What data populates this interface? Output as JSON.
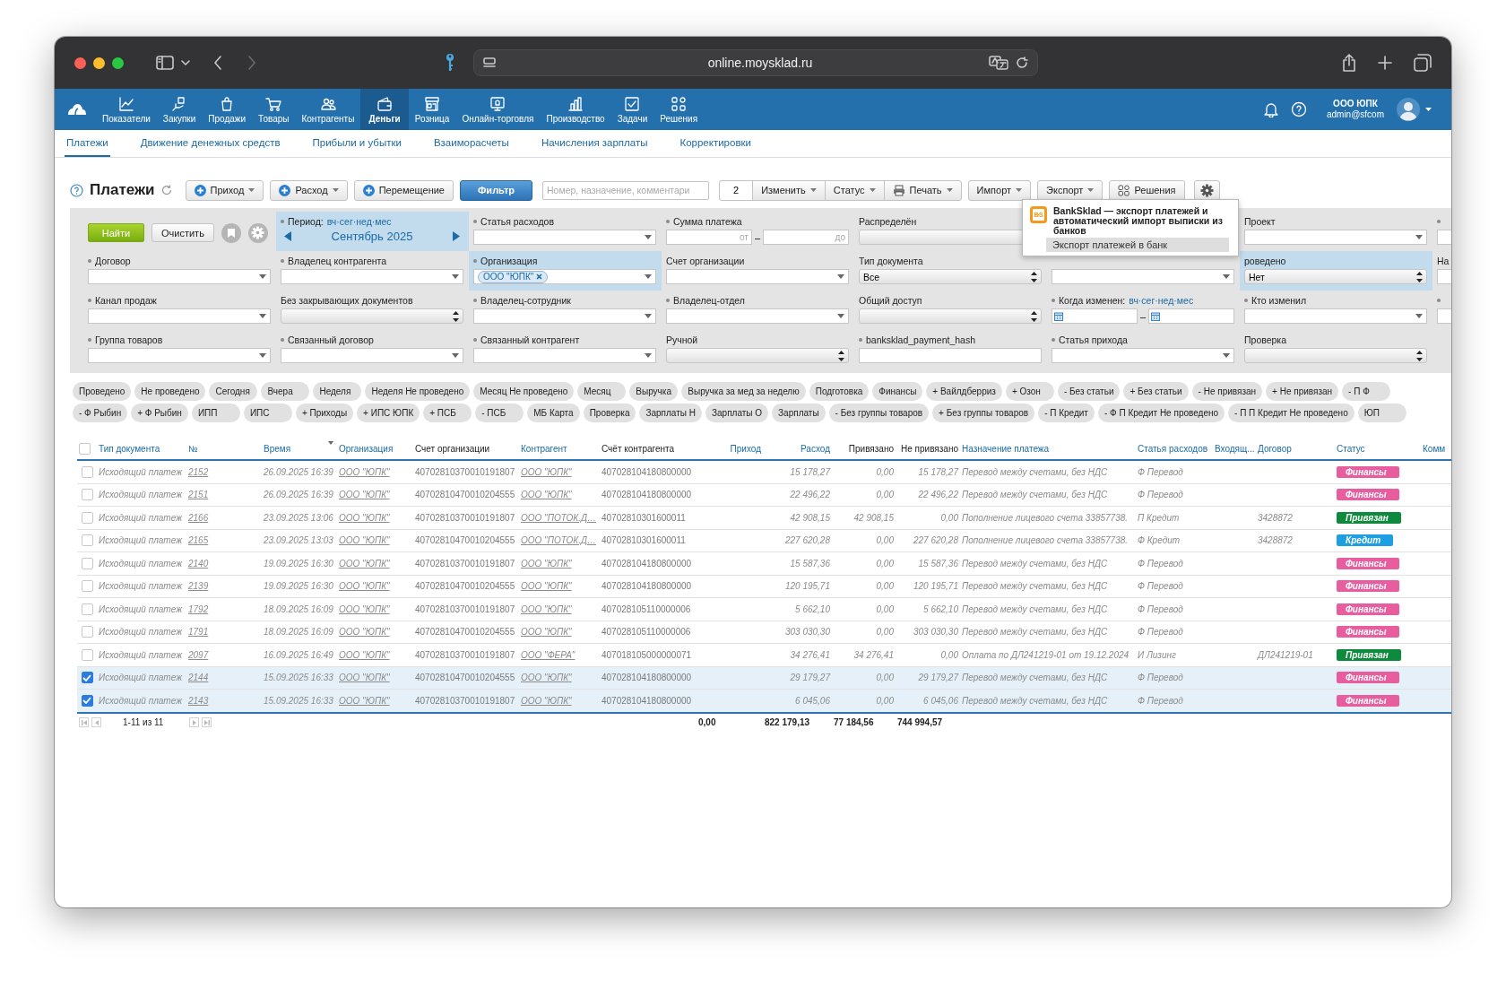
{
  "browser": {
    "url": "online.moysklad.ru"
  },
  "nav": {
    "items": [
      {
        "label": "Показатели",
        "selected": false
      },
      {
        "label": "Закупки",
        "selected": false
      },
      {
        "label": "Продажи",
        "selected": false
      },
      {
        "label": "Товары",
        "selected": false
      },
      {
        "label": "Контрагенты",
        "selected": false
      },
      {
        "label": "Деньги",
        "selected": true
      },
      {
        "label": "Розница",
        "selected": false
      },
      {
        "label": "Онлайн-торговля",
        "selected": false
      },
      {
        "label": "Производство",
        "selected": false
      },
      {
        "label": "Задачи",
        "selected": false
      },
      {
        "label": "Решения",
        "selected": false
      }
    ],
    "account": {
      "company": "ООО ЮПК",
      "email": "admin@sfcom"
    }
  },
  "subtabs": [
    {
      "label": "Платежи",
      "selected": true
    },
    {
      "label": "Движение денежных средств",
      "selected": false
    },
    {
      "label": "Прибыли и убытки",
      "selected": false
    },
    {
      "label": "Взаиморасчеты",
      "selected": false
    },
    {
      "label": "Начисления зарплаты",
      "selected": false
    },
    {
      "label": "Корректировки",
      "selected": false
    }
  ],
  "toolbar": {
    "title": "Платежи",
    "create_buttons": [
      {
        "label": "Приход",
        "caret": true
      },
      {
        "label": "Расход",
        "caret": true
      },
      {
        "label": "Перемещение",
        "caret": false
      }
    ],
    "filter_button": {
      "label": "Фильтр",
      "on": true
    },
    "search": {
      "placeholder": "Номер, назначение, комментари"
    },
    "selected_count": "2",
    "selection_menus": [
      {
        "label": "Изменить",
        "kind": "menu"
      },
      {
        "label": "Статус",
        "kind": "menu"
      },
      {
        "label": "Печать",
        "kind": "print"
      }
    ],
    "menus": [
      {
        "label": "Импорт",
        "kind": "menu"
      },
      {
        "label": "Экспорт",
        "kind": "menu"
      },
      {
        "label": "Решения",
        "kind": "apps"
      }
    ]
  },
  "solutions_popup": {
    "logo": "BS",
    "title": "BankSklad — экспорт платежей и автоматический импорт выписки из банков",
    "items": [
      {
        "label": "Экспорт платежей в банк",
        "selected": true
      }
    ]
  },
  "filter": {
    "rows": [
      [
        {
          "kind": "actions",
          "find": "Найти",
          "clear": "Очистить"
        },
        {
          "kind": "period",
          "label": "Период:",
          "shortcuts": "вч·сег·нед·мес",
          "month": "Сентябрь 2025",
          "highlighted": true
        },
        {
          "label": "Статья расходов",
          "bullet": true,
          "kind": "combo"
        },
        {
          "label": "Сумма платежа",
          "bullet": true,
          "kind": "range",
          "inputs": [
            {
              "placeholder": "от"
            },
            {
              "placeholder": "до"
            }
          ],
          "separator": "–"
        },
        {
          "label": "Распределён",
          "bullet": false,
          "kind": "select"
        },
        "",
        {
          "label": "Проект",
          "bullet": false,
          "kind": "combo"
        },
        {
          "bullet": true,
          "kind": "combo"
        }
      ],
      [
        {
          "label": "Договор",
          "bullet": true,
          "kind": "combo"
        },
        {
          "label": "Владелец контрагента",
          "bullet": true,
          "kind": "combo"
        },
        {
          "label": "Организация",
          "bullet": true,
          "kind": "chips",
          "highlighted": true,
          "chips": [
            "ООО \"ЮПК\""
          ]
        },
        {
          "label": "Счет организации",
          "bullet": false,
          "kind": "combo"
        },
        {
          "label": "Тип документа",
          "bullet": false,
          "kind": "select",
          "value": "Все"
        },
        {
          "bullet": false,
          "kind": "combo"
        },
        {
          "label": "роведено",
          "bullet": false,
          "kind": "select",
          "value": "Нет",
          "highlighted": true
        },
        {
          "label": "На",
          "bullet": false,
          "kind": "combo"
        }
      ],
      [
        {
          "label": "Канал продаж",
          "bullet": true,
          "kind": "combo"
        },
        {
          "label": "Без закрывающих документов",
          "bullet": false,
          "kind": "select"
        },
        {
          "label": "Владелец-сотрудник",
          "bullet": true,
          "kind": "combo"
        },
        {
          "label": "Владелец-отдел",
          "bullet": true,
          "kind": "combo"
        },
        {
          "label": "Общий доступ",
          "bullet": false,
          "kind": "select"
        },
        {
          "label": "Когда изменен:",
          "bullet": true,
          "kind": "dates",
          "shortcuts": "вч·сег·нед·мес",
          "separator": "–"
        },
        {
          "label": "Кто изменил",
          "bullet": true,
          "kind": "combo"
        },
        {
          "bullet": true,
          "kind": "combo"
        }
      ],
      [
        {
          "label": "Группа товаров",
          "bullet": true,
          "kind": "combo"
        },
        {
          "label": "Связанный договор",
          "bullet": true,
          "kind": "combo"
        },
        {
          "label": "Связанный контрагент",
          "bullet": true,
          "kind": "combo"
        },
        {
          "label": "Ручной",
          "bullet": false,
          "kind": "select"
        },
        {
          "label": "banksklad_payment_hash",
          "bullet": true,
          "kind": "text"
        },
        {
          "label": "Статья прихода",
          "bullet": true,
          "kind": "combo"
        },
        {
          "label": "Проверка",
          "bullet": false,
          "kind": "select"
        }
      ]
    ]
  },
  "quick_filters": [
    [
      "Проведено",
      "Не проведено",
      "Сегодня",
      "Вчера",
      "Неделя",
      "Неделя Не проведено",
      "Месяц Не проведено",
      "Месяц",
      "Выручка",
      "Выручка за мед за неделю",
      "Подготовка",
      "Финансы",
      "+ Вайлдберриз",
      "+ Озон",
      "- Без статьи",
      "+ Без статьи",
      "- Не привязан",
      "+ Не привязан",
      "- П Ф"
    ],
    [
      "- Ф Рыбин",
      "+ Ф Рыбин",
      "ИПП",
      "ИПС",
      "+ Приходы",
      "+ ИПС ЮПК",
      "+ ПСБ",
      "- ПСБ",
      "МБ Карта",
      "Проверка",
      "Зарплаты Н",
      "Зарплаты О",
      "Зарплаты",
      "- Без группы товаров",
      "+ Без группы товаров",
      "- П Кредит",
      "- Ф П Кредит Не проведено",
      "- П П Кредит Не проведено",
      "ЮП"
    ]
  ],
  "table": {
    "all_selected": false,
    "columns": [
      {
        "label": "Тип документа",
        "kind": "text",
        "sortable": true,
        "sorted": false
      },
      {
        "label": "№",
        "kind": "link",
        "sortable": true,
        "sorted": false
      },
      {
        "label": "Время",
        "kind": "text",
        "sortable": true,
        "sorted": true
      },
      {
        "label": "Организация",
        "kind": "link",
        "sortable": true,
        "sorted": false
      },
      {
        "label": "Счет организации",
        "kind": "code",
        "sortable": false,
        "sorted": false
      },
      {
        "label": "Контрагент",
        "kind": "link",
        "sortable": true,
        "sorted": false
      },
      {
        "label": "Счёт контрагента",
        "kind": "code",
        "sortable": false,
        "sorted": false
      },
      {
        "label": "Приход",
        "kind": "number",
        "sortable": true,
        "sorted": false
      },
      {
        "label": "Расход",
        "kind": "number",
        "sortable": true,
        "sorted": false
      },
      {
        "label": "Привязано",
        "kind": "number",
        "sortable": false,
        "sorted": false
      },
      {
        "label": "Не привязано",
        "kind": "number",
        "sortable": false,
        "sorted": false
      },
      {
        "label": "Назначение платежа",
        "kind": "text",
        "sortable": true,
        "sorted": false
      },
      {
        "label": "Статья расходов",
        "kind": "text",
        "sortable": true,
        "sorted": false
      },
      {
        "label": "Входящ...",
        "kind": "text",
        "sortable": true,
        "sorted": false
      },
      {
        "label": "Договор",
        "kind": "text",
        "sortable": true,
        "sorted": false
      },
      {
        "label": "Статус",
        "kind": "status",
        "sortable": true,
        "sorted": false
      },
      {
        "label": "Комм",
        "kind": "text",
        "sortable": true,
        "sorted": false
      }
    ],
    "rows": [
      {
        "selected": false,
        "cells": [
          "Исходящий платеж",
          "2152",
          "26.09.2025 16:39",
          "ООО \"ЮПК\"",
          "40702810370010191807",
          "ООО \"ЮПК\"",
          "407028104180800000",
          null,
          "15 178,27",
          "0,00",
          "15 178,27",
          "Перевод между счетами, без НДС",
          "Ф Перевод",
          null,
          null,
          {
            "label": "Финансы",
            "color": "#e85d9e"
          },
          null
        ]
      },
      {
        "selected": false,
        "cells": [
          "Исходящий платеж",
          "2151",
          "26.09.2025 16:39",
          "ООО \"ЮПК\"",
          "40702810470010204555",
          "ООО \"ЮПК\"",
          "407028104180800000",
          null,
          "22 496,22",
          "0,00",
          "22 496,22",
          "Перевод между счетами, без НДС",
          "Ф Перевод",
          null,
          null,
          {
            "label": "Финансы",
            "color": "#e85d9e"
          },
          null
        ]
      },
      {
        "selected": false,
        "cells": [
          "Исходящий платеж",
          "2166",
          "23.09.2025 13:06",
          "ООО \"ЮПК\"",
          "40702810370010191807",
          "ООО \"ПОТОК.Д…",
          "40702810301600011",
          null,
          "42 908,15",
          "42 908,15",
          "0,00",
          "Пополнение лицевого счета 33857738.",
          "П Кредит",
          null,
          "3428872",
          {
            "label": "Привязан",
            "color": "#0e8a3c"
          },
          null
        ]
      },
      {
        "selected": false,
        "cells": [
          "Исходящий платеж",
          "2165",
          "23.09.2025 13:03",
          "ООО \"ЮПК\"",
          "40702810470010204555",
          "ООО \"ПОТОК.Д…",
          "40702810301600011",
          null,
          "227 620,28",
          "0,00",
          "227 620,28",
          "Пополнение лицевого счета 33857738.",
          "Ф Кредит",
          null,
          "3428872",
          {
            "label": "Кредит",
            "color": "#1e9fe3"
          },
          null
        ]
      },
      {
        "selected": false,
        "cells": [
          "Исходящий платеж",
          "2140",
          "19.09.2025 16:30",
          "ООО \"ЮПК\"",
          "40702810370010191807",
          "ООО \"ЮПК\"",
          "407028104180800000",
          null,
          "15 587,36",
          "0,00",
          "15 587,36",
          "Перевод между счетами, без НДС",
          "Ф Перевод",
          null,
          null,
          {
            "label": "Финансы",
            "color": "#e85d9e"
          },
          null
        ]
      },
      {
        "selected": false,
        "cells": [
          "Исходящий платеж",
          "2139",
          "19.09.2025 16:30",
          "ООО \"ЮПК\"",
          "40702810470010204555",
          "ООО \"ЮПК\"",
          "407028104180800000",
          null,
          "120 195,71",
          "0,00",
          "120 195,71",
          "Перевод между счетами, без НДС",
          "Ф Перевод",
          null,
          null,
          {
            "label": "Финансы",
            "color": "#e85d9e"
          },
          null
        ]
      },
      {
        "selected": false,
        "cells": [
          "Исходящий платеж",
          "1792",
          "18.09.2025 16:09",
          "ООО \"ЮПК\"",
          "40702810370010191807",
          "ООО \"ЮПК\"",
          "407028105110000006",
          null,
          "5 662,10",
          "0,00",
          "5 662,10",
          "Перевод между счетами, без НДС",
          "Ф Перевод",
          null,
          null,
          {
            "label": "Финансы",
            "color": "#e85d9e"
          },
          null
        ]
      },
      {
        "selected": false,
        "cells": [
          "Исходящий платеж",
          "1791",
          "18.09.2025 16:09",
          "ООО \"ЮПК\"",
          "40702810470010204555",
          "ООО \"ЮПК\"",
          "407028105110000006",
          null,
          "303 030,30",
          "0,00",
          "303 030,30",
          "Перевод между счетами, без НДС",
          "Ф Перевод",
          null,
          null,
          {
            "label": "Финансы",
            "color": "#e85d9e"
          },
          null
        ]
      },
      {
        "selected": false,
        "cells": [
          "Исходящий платеж",
          "2097",
          "16.09.2025 16:49",
          "ООО \"ЮПК\"",
          "40702810370010191807",
          "ООО \"ФЕРА\"",
          "407018105000000071",
          null,
          "34 276,41",
          "34 276,41",
          "0,00",
          "Оплата по ДЛ241219-01 от 19.12.2024",
          "И Лизинг",
          null,
          "ДЛ241219-01",
          {
            "label": "Привязан",
            "color": "#0e8a3c"
          },
          null
        ]
      },
      {
        "selected": true,
        "cells": [
          "Исходящий платеж",
          "2144",
          "15.09.2025 16:33",
          "ООО \"ЮПК\"",
          "40702810470010204555",
          "ООО \"ЮПК\"",
          "407028104180800000",
          null,
          "29 179,27",
          "0,00",
          "29 179,27",
          "Перевод между счетами, без НДС",
          "Ф Перевод",
          null,
          null,
          {
            "label": "Финансы",
            "color": "#e85d9e"
          },
          null
        ]
      },
      {
        "selected": true,
        "cells": [
          "Исходящий платеж",
          "2143",
          "15.09.2025 16:33",
          "ООО \"ЮПК\"",
          "40702810370010191807",
          "ООО \"ЮПК\"",
          "407028104180800000",
          null,
          "6 045,06",
          "0,00",
          "6 045,06",
          "Перевод между счетами, без НДС",
          "Ф Перевод",
          null,
          null,
          {
            "label": "Финансы",
            "color": "#e85d9e"
          },
          null
        ]
      }
    ],
    "footer": {
      "pager": "1-11 из 11",
      "totals": [
        "0,00",
        "822 179,13",
        "77 184,56",
        "744 994,57"
      ]
    }
  }
}
